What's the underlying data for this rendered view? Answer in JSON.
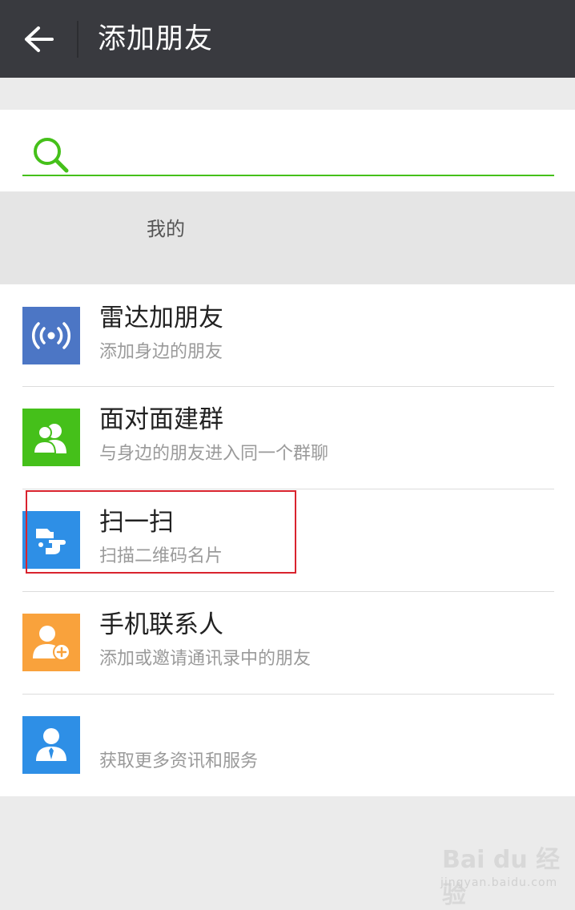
{
  "header": {
    "title": "添加朋友"
  },
  "search": {
    "placeholder": "",
    "value": ""
  },
  "my_id": {
    "label": "我的"
  },
  "items": [
    {
      "title": "雷达加朋友",
      "desc": "添加身边的朋友",
      "icon": "radar-icon",
      "color": "#4c76c5"
    },
    {
      "title": "面对面建群",
      "desc": "与身边的朋友进入同一个群聊",
      "icon": "group-icon",
      "color": "#45c01a"
    },
    {
      "title": "扫一扫",
      "desc": "扫描二维码名片",
      "icon": "scan-icon",
      "color": "#2e8fe6"
    },
    {
      "title": "手机联系人",
      "desc": "添加或邀请通讯录中的朋友",
      "icon": "add-contact-icon",
      "color": "#f9a23c"
    },
    {
      "title": "",
      "desc": "获取更多资讯和服务",
      "icon": "official-account-icon",
      "color": "#2e8fe6"
    }
  ],
  "watermark": {
    "logo": "Bai du 经验",
    "url": "jingyan.baidu.com"
  },
  "colors": {
    "header_bg": "#393a3f",
    "accent_green": "#45c01a",
    "highlight_red": "#d9232e"
  }
}
